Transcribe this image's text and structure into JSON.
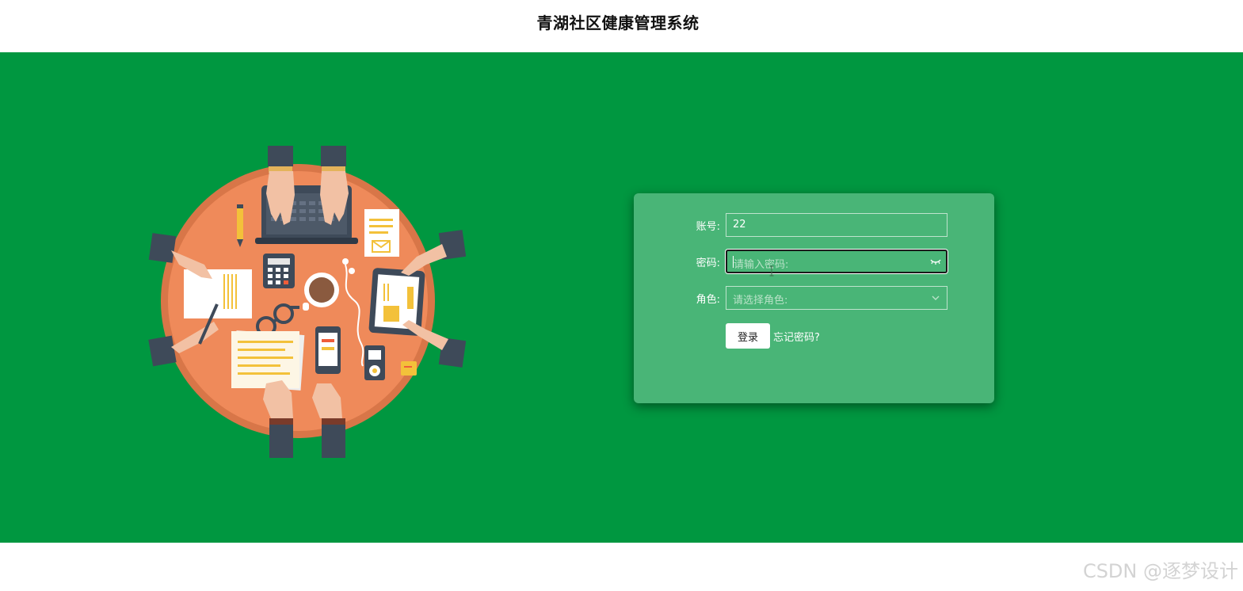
{
  "header": {
    "title": "青湖社区健康管理系统"
  },
  "login": {
    "account_label": "账号:",
    "account_value": "22",
    "password_label": "密码:",
    "password_placeholder": "请输入密码:",
    "role_label": "角色:",
    "role_placeholder": "请选择角色:",
    "login_button": "登录",
    "forgot_link": "忘记密码?"
  },
  "icons": {
    "password_toggle": "eye-closed-icon",
    "role_dropdown": "chevron-down-icon"
  },
  "colors": {
    "main_background": "#009740",
    "panel_background": "#49b577",
    "table_orange": "#ef8a5a"
  },
  "watermark": "CSDN @逐梦设计"
}
